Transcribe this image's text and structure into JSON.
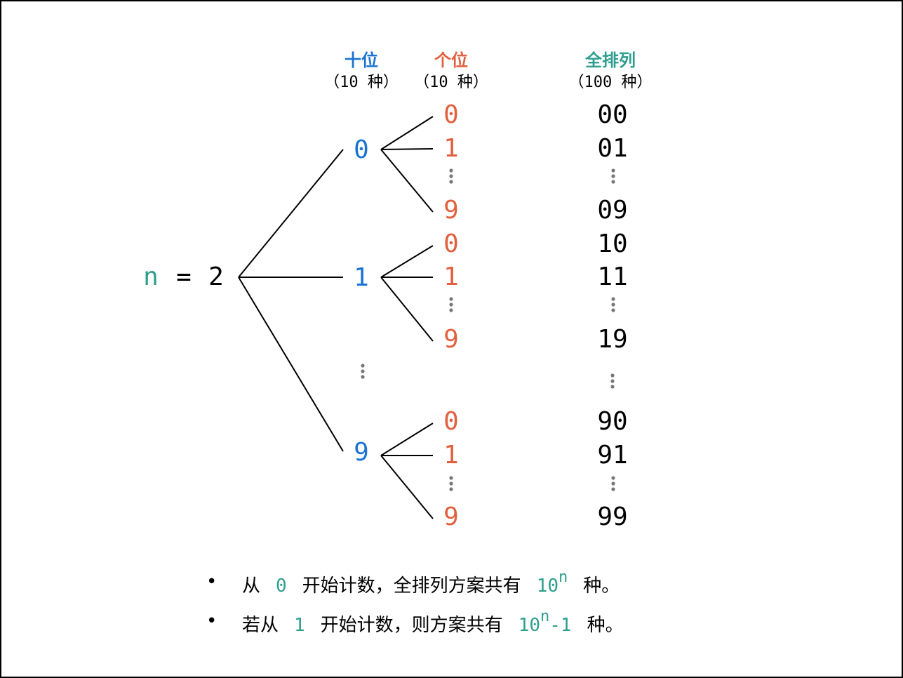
{
  "headers": {
    "tens": {
      "title": "十位",
      "sub": "（10 种）"
    },
    "ones": {
      "title": "个位",
      "sub": "（10 种）"
    },
    "all": {
      "title": "全排列",
      "sub": "（100 种）"
    }
  },
  "root": {
    "var": "n",
    "eq": "=",
    "val": "2"
  },
  "tens_digits": [
    "0",
    "1",
    "9"
  ],
  "ones_groups": [
    [
      "0",
      "1",
      "9"
    ],
    [
      "0",
      "1",
      "9"
    ],
    [
      "0",
      "1",
      "9"
    ]
  ],
  "results": [
    [
      "00",
      "01",
      "09"
    ],
    [
      "10",
      "11",
      "19"
    ],
    [
      "90",
      "91",
      "99"
    ]
  ],
  "colors": {
    "tens": "#1a73d2",
    "ones": "#e0603f",
    "accent": "#2e9e8e",
    "text": "#000000",
    "ellipsis": "#777777"
  },
  "notes": [
    {
      "bullet": "•",
      "pre": "从",
      "code": "0",
      "mid": "开始计数，全排列方案共有",
      "base": "10",
      "exp": "n",
      "tail": "",
      "post": "种。"
    },
    {
      "bullet": "•",
      "pre": "若从",
      "code": "1",
      "mid": "开始计数，则方案共有",
      "base": "10",
      "exp": "n",
      "tail": "-1",
      "post": "种。"
    }
  ]
}
